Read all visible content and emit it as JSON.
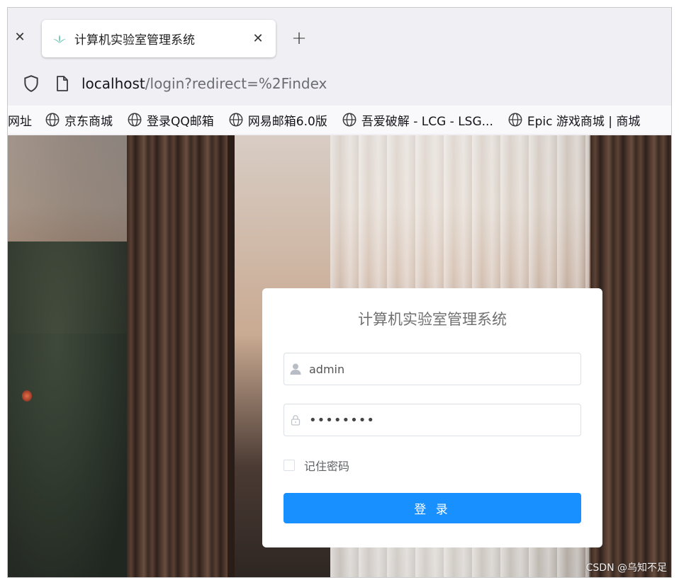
{
  "browser": {
    "tab": {
      "title": "计算机实验室管理系统",
      "favicon": "element-ui-leaf-icon"
    },
    "url": {
      "host": "localhost",
      "path": "/login?redirect=%2Findex"
    },
    "bookmarks": [
      {
        "label": "网址"
      },
      {
        "label": "京东商城"
      },
      {
        "label": "登录QQ邮箱"
      },
      {
        "label": "网易邮箱6.0版"
      },
      {
        "label": "吾爱破解 - LCG - LSG..."
      },
      {
        "label": "Epic 游戏商城 | 商城"
      }
    ]
  },
  "login": {
    "title": "计算机实验室管理系统",
    "username": "admin",
    "password_mask": "••••••••",
    "remember_label": "记住密码",
    "remember_checked": false,
    "submit_label": "登 录",
    "submit_color": "#1890ff"
  },
  "watermark": "CSDN @乌知不足"
}
